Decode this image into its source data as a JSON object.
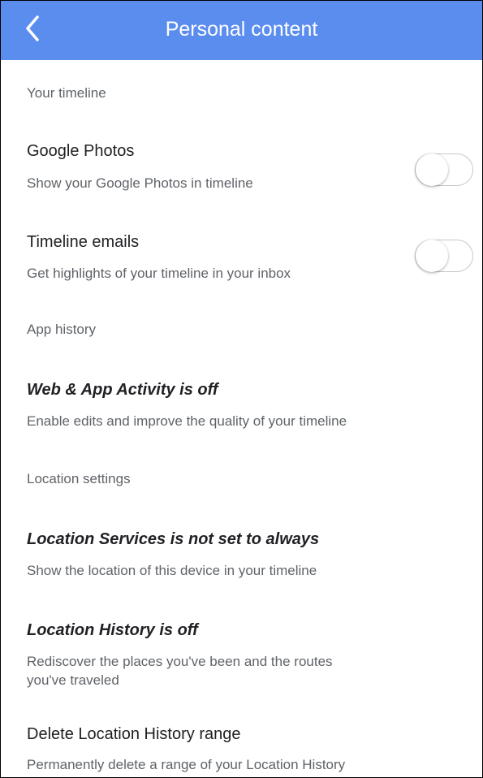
{
  "appbar": {
    "title": "Personal content",
    "color": "#5b8def",
    "back_icon": "chevron-left-icon"
  },
  "sections": {
    "timeline": {
      "header": "Your timeline",
      "google_photos": {
        "title": "Google Photos",
        "subtitle": "Show your Google Photos in timeline",
        "enabled": false
      },
      "timeline_emails": {
        "title": "Timeline emails",
        "subtitle": "Get highlights of your timeline in your inbox",
        "enabled": false
      }
    },
    "app_history": {
      "header": "App history",
      "web_app_activity": {
        "title": "Web & App Activity is off",
        "subtitle": "Enable edits and improve the quality of your timeline"
      }
    },
    "location_settings": {
      "header": "Location settings",
      "location_services": {
        "title": "Location Services is not set to always",
        "subtitle": "Show the location of this device in your timeline"
      },
      "location_history": {
        "title": "Location History is off",
        "subtitle_line1": "Rediscover the places you've been and the routes",
        "subtitle_line2": "you've traveled"
      },
      "delete_range": {
        "title": "Delete Location History range",
        "subtitle": "Permanently delete a range of your Location History"
      }
    }
  }
}
